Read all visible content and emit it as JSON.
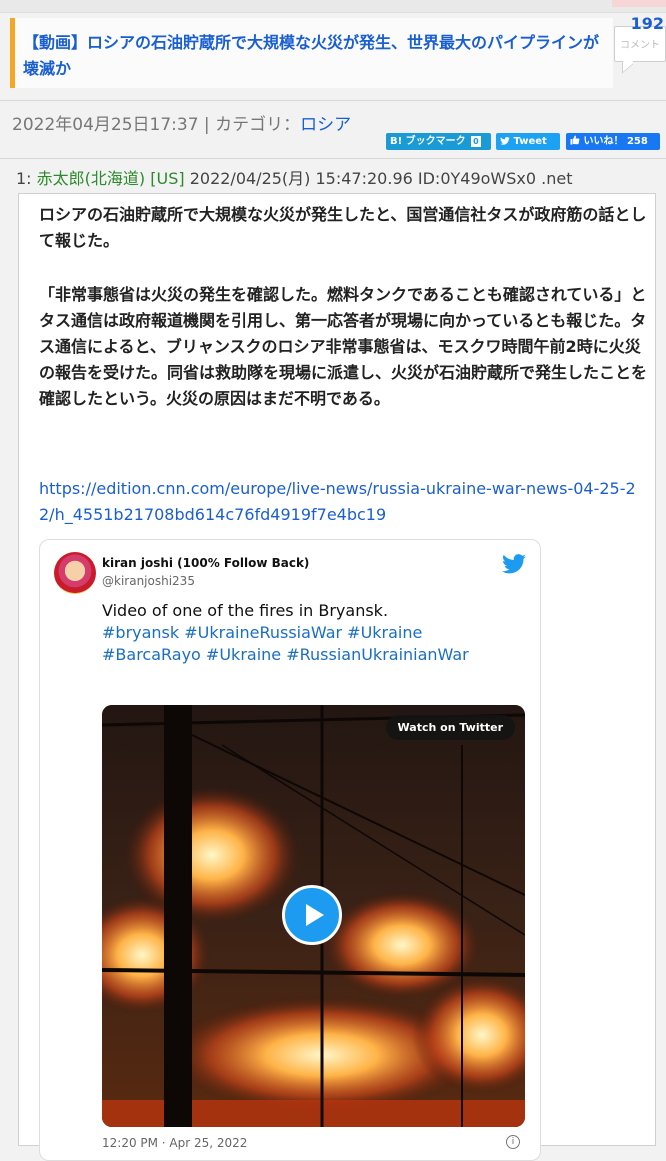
{
  "article": {
    "title": "【動画】ロシアの石油貯蔵所で大規模な火災が発生、世界最大のパイプラインが壊滅か",
    "comment_count": "192",
    "comment_label": "コメント",
    "datetime": "2022年04月25日17:37",
    "category_prefix": " | カテゴリ：",
    "category": "ロシア"
  },
  "social": {
    "hatena_label": "B! ブックマーク",
    "hatena_count": "0",
    "tweet_label": "Tweet",
    "like_label": "いいね！ 258"
  },
  "post": {
    "number": "1:",
    "name": "赤太郎(北海道) [US]",
    "date_id": "2022/04/25(月) 15:47:20.96 ID:0Y49oWSx0 .net",
    "paragraph1": "ロシアの石油貯蔵所で大規模な火災が発生したと、国営通信社タスが政府筋の話として報じた。",
    "paragraph2": "「非常事態省は火災の発生を確認した。燃料タンクであることも確認されている」とタス通信は政府報道機関を引用し、第一応答者が現場に向かっているとも報じた。タス通信によると、ブリャンスクのロシア非常事態省は、モスクワ時間午前2時に火災の報告を受けた。同省は救助隊を現場に派遣し、火災が石油貯蔵所で発生したことを確認したという。火災の原因はまだ不明である。",
    "link": "https://edition.cnn.com/europe/live-news/russia-ukraine-war-news-04-25-22/h_4551b21708bd614c76fd4919f7e4bc19"
  },
  "tweet": {
    "name": "kiran joshi (100% Follow Back)",
    "handle": "@kiranjoshi235",
    "text": "Video of one of the fires in Bryansk.",
    "tags": "#bryansk #UkraineRussiaWar #Ukraine #BarcaRayo #Ukraine #RussianUkrainianWar",
    "watch_label": "Watch on Twitter",
    "time": "12:20 PM · Apr 25, 2022",
    "info": "i"
  },
  "colors": {
    "link": "#1a5fd1",
    "accent_bar": "#f5a623",
    "poster_name": "#2c8a2c",
    "twitter": "#1d9bf0"
  }
}
